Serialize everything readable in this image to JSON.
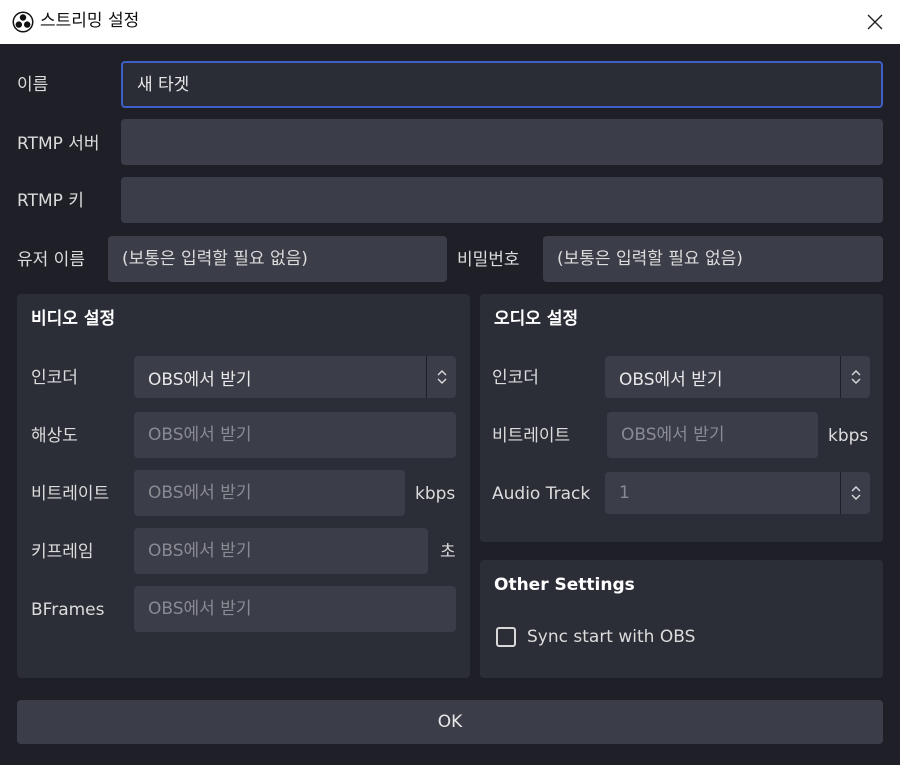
{
  "window": {
    "title": "스트리밍 설정"
  },
  "form": {
    "name_label": "이름",
    "name_value": "새 타겟",
    "rtmp_server_label": "RTMP 서버",
    "rtmp_server_value": "",
    "rtmp_key_label": "RTMP 키",
    "rtmp_key_value": "",
    "username_label": "유저 이름",
    "username_placeholder": "(보통은 입력할 필요 없음)",
    "password_label": "비밀번호",
    "password_placeholder": "(보통은 입력할 필요 없음)"
  },
  "video": {
    "title": "비디오 설정",
    "encoder_label": "인코더",
    "encoder_value": "OBS에서 받기",
    "resolution_label": "해상도",
    "resolution_placeholder": "OBS에서 받기",
    "bitrate_label": "비트레이트",
    "bitrate_placeholder": "OBS에서 받기",
    "bitrate_unit": "kbps",
    "keyframe_label": "키프레임",
    "keyframe_placeholder": "OBS에서 받기",
    "keyframe_unit": "초",
    "bframes_label": "BFrames",
    "bframes_placeholder": "OBS에서 받기"
  },
  "audio": {
    "title": "오디오 설정",
    "encoder_label": "인코더",
    "encoder_value": "OBS에서 받기",
    "bitrate_label": "비트레이트",
    "bitrate_placeholder": "OBS에서 받기",
    "bitrate_unit": "kbps",
    "track_label": "Audio Track",
    "track_value": "1"
  },
  "other": {
    "title": "Other Settings",
    "sync_label": "Sync start with OBS",
    "sync_checked": false
  },
  "ok_label": "OK",
  "icons": {
    "app": "obs-logo-icon",
    "close": "close-icon",
    "spinner": "up-down-chevron-icon"
  }
}
